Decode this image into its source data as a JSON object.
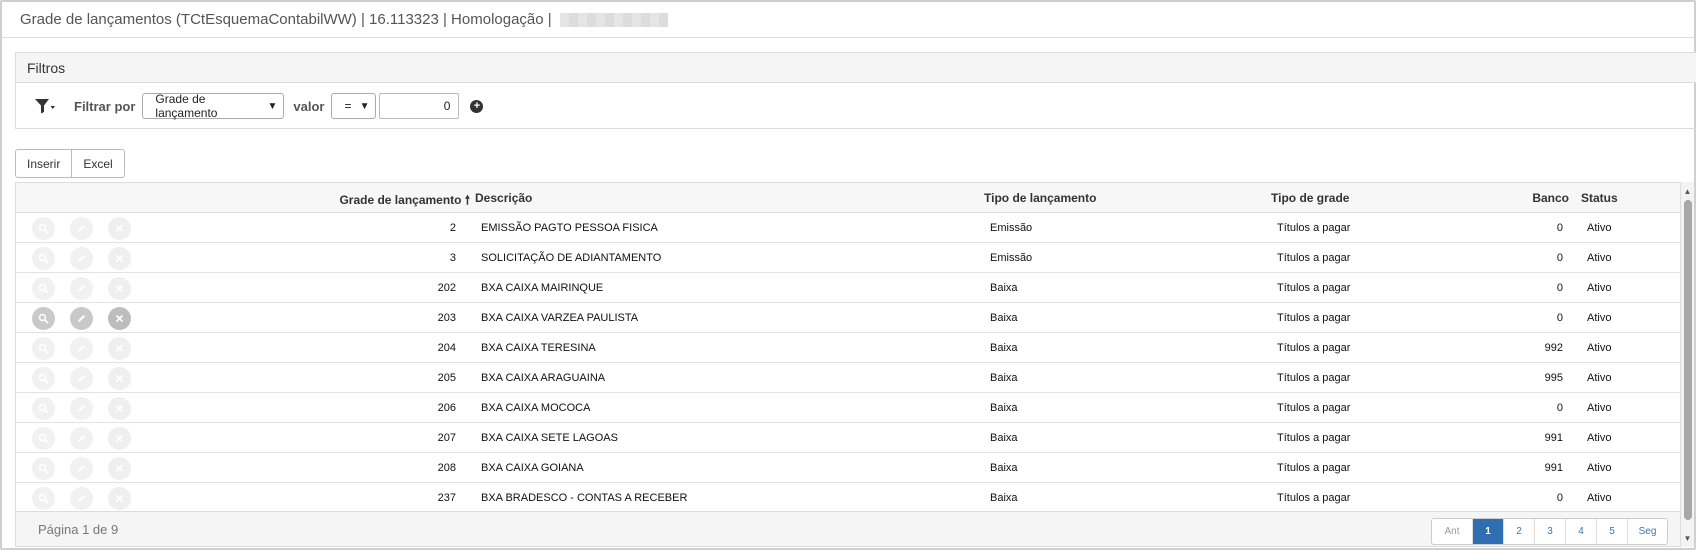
{
  "window": {
    "title": "Grade de lançamentos (TCtEsquemaContabilWW) | 16.113323 | Homologação |"
  },
  "filters": {
    "header": "Filtros",
    "filter_by_label": "Filtrar por",
    "field_selected": "Grade de lançamento",
    "value_label": "valor",
    "operator_selected": "=",
    "value": "0"
  },
  "toolbar": {
    "insert_label": "Inserir",
    "excel_label": "Excel"
  },
  "grid": {
    "columns": {
      "grade": "Grade de lançamento",
      "sort_indicator": "🠕",
      "descricao": "Descrição",
      "tipo_lancamento": "Tipo de lançamento",
      "tipo_grade": "Tipo de grade",
      "banco": "Banco",
      "status": "Status"
    },
    "rows": [
      {
        "grade": "2",
        "descricao": "EMISSÃO PAGTO PESSOA FISICA",
        "tipo_lancamento": "Emissão",
        "tipo_grade": "Títulos a pagar",
        "banco": "0",
        "status": "Ativo"
      },
      {
        "grade": "3",
        "descricao": "SOLICITAÇÃO DE ADIANTAMENTO",
        "tipo_lancamento": "Emissão",
        "tipo_grade": "Títulos a pagar",
        "banco": "0",
        "status": "Ativo"
      },
      {
        "grade": "202",
        "descricao": "BXA CAIXA MAIRINQUE",
        "tipo_lancamento": "Baixa",
        "tipo_grade": "Títulos a pagar",
        "banco": "0",
        "status": "Ativo"
      },
      {
        "grade": "203",
        "descricao": "BXA CAIXA VARZEA PAULISTA",
        "tipo_lancamento": "Baixa",
        "tipo_grade": "Títulos a pagar",
        "banco": "0",
        "status": "Ativo",
        "hover": true
      },
      {
        "grade": "204",
        "descricao": "BXA CAIXA TERESINA",
        "tipo_lancamento": "Baixa",
        "tipo_grade": "Títulos a pagar",
        "banco": "992",
        "status": "Ativo"
      },
      {
        "grade": "205",
        "descricao": "BXA CAIXA ARAGUAINA",
        "tipo_lancamento": "Baixa",
        "tipo_grade": "Títulos a pagar",
        "banco": "995",
        "status": "Ativo"
      },
      {
        "grade": "206",
        "descricao": "BXA CAIXA MOCOCA",
        "tipo_lancamento": "Baixa",
        "tipo_grade": "Títulos a pagar",
        "banco": "0",
        "status": "Ativo"
      },
      {
        "grade": "207",
        "descricao": "BXA CAIXA SETE LAGOAS",
        "tipo_lancamento": "Baixa",
        "tipo_grade": "Títulos a pagar",
        "banco": "991",
        "status": "Ativo"
      },
      {
        "grade": "208",
        "descricao": "BXA CAIXA GOIANA",
        "tipo_lancamento": "Baixa",
        "tipo_grade": "Títulos a pagar",
        "banco": "991",
        "status": "Ativo"
      },
      {
        "grade": "237",
        "descricao": "BXA BRADESCO - CONTAS A RECEBER",
        "tipo_lancamento": "Baixa",
        "tipo_grade": "Títulos a pagar",
        "banco": "0",
        "status": "Ativo"
      }
    ],
    "row_icons": [
      "search-icon",
      "edit-icon",
      "delete-icon"
    ]
  },
  "pagination": {
    "info": "Página 1 de 9",
    "prev": "Ant",
    "pages": [
      "1",
      "2",
      "3",
      "4",
      "5"
    ],
    "current": "1",
    "next": "Seg"
  },
  "colors": {
    "active_page": "#2f6eb0",
    "link": "#3a76b8"
  }
}
